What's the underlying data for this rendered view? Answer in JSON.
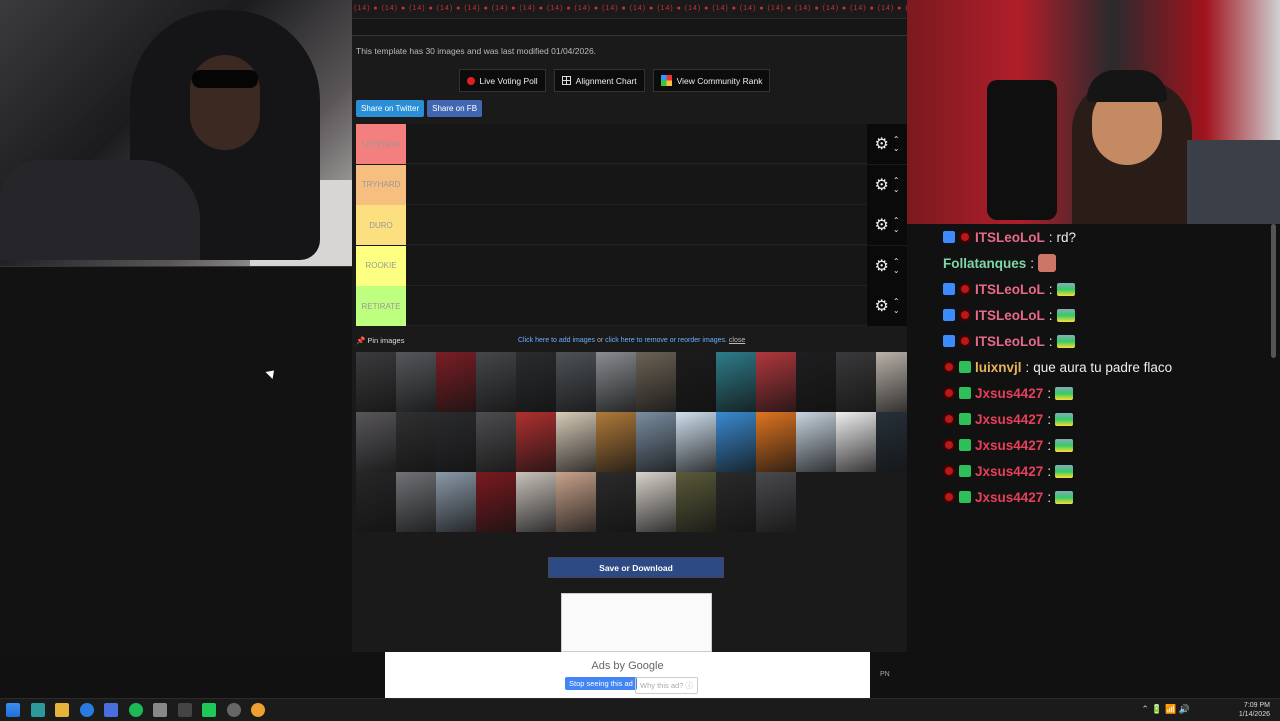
{
  "site": {
    "ticker": "(14) ● (14) ● (14) ● (14) ● (14) ● (14) ● (14) ● (14) ● (14) ● (14) ● (14) ● (14) ● (14) ● (14) ● (14) ● (14) ● (14) ● (14) ● (14) ● (14) ● (14) ● (14) ● (14) ● (14) ●",
    "info": "This template has 30 images and was last modified 01/04/2026.",
    "buttons": {
      "poll": "Live Voting Poll",
      "alignment": "Alignment Chart",
      "rank": "View Community Rank"
    },
    "share": {
      "twitter": "Share on Twitter",
      "fb": "Share on FB"
    },
    "tiers": [
      {
        "label": "LEYENDA",
        "color": "#f47f7f"
      },
      {
        "label": "TRYHARD",
        "color": "#f7bf7f"
      },
      {
        "label": "DURO",
        "color": "#fcdf7f"
      },
      {
        "label": "ROOKIE",
        "color": "#fcff7f"
      },
      {
        "label": "RETIRATE",
        "color": "#bfff7f"
      }
    ],
    "pin": "Pin images",
    "add": {
      "link1": "Click here to add images",
      "or": " or ",
      "link2": "click here to remove or reorder images.",
      "close": "close"
    },
    "save": "Save or Download",
    "thumbs": [
      "#3b3b3d",
      "#55585c",
      "#7a1e25",
      "#45474a",
      "#2a2c2f",
      "#4e5358",
      "#8a8c90",
      "#6b6255",
      "#1c1c1d",
      "#2e7c8a",
      "#b0383d",
      "#1e1e20",
      "#3a3a3c",
      "#b9b2aa",
      "#58565a",
      "#303032",
      "#2a2b2e",
      "#4d4d50",
      "#b03030",
      "#d8cbb8",
      "#b07a3a",
      "#7a8da0",
      "#cfe0ee",
      "#3a8ad0",
      "#e07420",
      "#c7d4e0",
      "#efefef",
      "#27303a",
      "#262628",
      "#707276",
      "#8a99a8",
      "#7a1a20",
      "#c9c2bb",
      "#c9a38c",
      "#2b2b2d",
      "#d8d3cc",
      "#5a5a3a",
      "#2a2a2a",
      "#4a4a4e"
    ]
  },
  "ad": {
    "by": "Ads by Google",
    "stop": "Stop seeing this ad",
    "why": "Why this ad? ⓘ",
    "pn": "PN"
  },
  "chat": [
    {
      "user": "ITSLeoLoL",
      "color": "#e86a8a",
      "badges": [
        "blue",
        "red"
      ],
      "text": "rd?",
      "emote": false
    },
    {
      "user": "Follatanques",
      "color": "#7fd6a6",
      "badges": [],
      "text": "",
      "emote": true
    },
    {
      "user": "ITSLeoLoL",
      "color": "#e86a8a",
      "badges": [
        "blue",
        "red"
      ],
      "text": "",
      "emote": true
    },
    {
      "user": "ITSLeoLoL",
      "color": "#e86a8a",
      "badges": [
        "blue",
        "red"
      ],
      "text": "",
      "emote": true
    },
    {
      "user": "ITSLeoLoL",
      "color": "#e86a8a",
      "badges": [
        "blue",
        "red"
      ],
      "text": "",
      "emote": true
    },
    {
      "user": "luixnvjl",
      "color": "#e7b35a",
      "badges": [
        "red",
        "green"
      ],
      "text": "que aura tu padre flaco",
      "emote": false
    },
    {
      "user": "Jxsus4427",
      "color": "#e8405a",
      "badges": [
        "red",
        "green"
      ],
      "text": "",
      "emote": true
    },
    {
      "user": "Jxsus4427",
      "color": "#e8405a",
      "badges": [
        "red",
        "green"
      ],
      "text": "",
      "emote": true
    },
    {
      "user": "Jxsus4427",
      "color": "#e8405a",
      "badges": [
        "red",
        "green"
      ],
      "text": "",
      "emote": true
    },
    {
      "user": "Jxsus4427",
      "color": "#e8405a",
      "badges": [
        "red",
        "green"
      ],
      "text": "",
      "emote": true
    },
    {
      "user": "Jxsus4427",
      "color": "#e8405a",
      "badges": [
        "red",
        "green"
      ],
      "text": "",
      "emote": true
    }
  ],
  "taskbar": {
    "time": "7:09 PM",
    "date": "1/14/2026"
  }
}
